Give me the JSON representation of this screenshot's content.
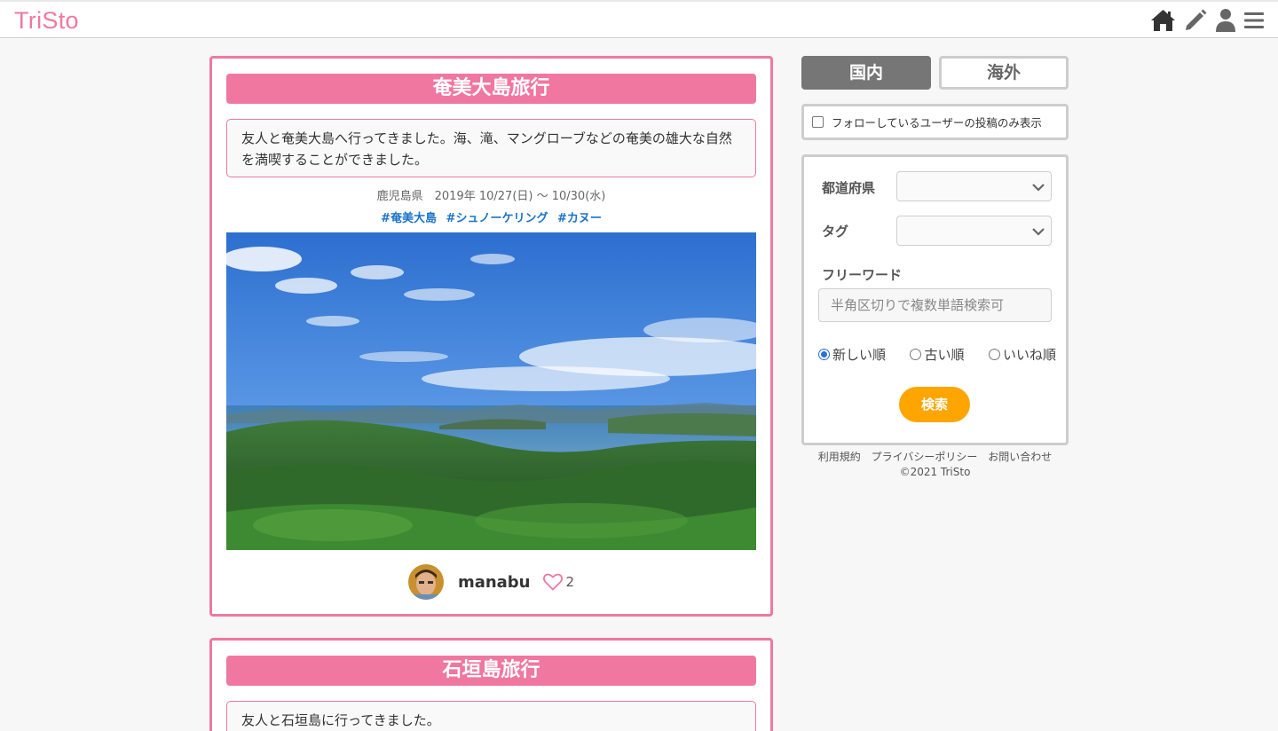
{
  "header": {
    "logo": "TriSto",
    "nav": [
      "home-icon",
      "pencil-icon",
      "user-icon",
      "menu-icon"
    ]
  },
  "posts": [
    {
      "title": "奄美大島旅行",
      "description": "友人と奄美大島へ行ってきました。海、滝、マングローブなどの奄美の雄大な自然を満喫することができました。",
      "meta": "鹿児島県　2019年 10/27(日) 〜 10/30(水)",
      "tags": [
        "#奄美大島",
        "#シュノーケリング",
        "#カヌー"
      ],
      "user": "manabu",
      "likes": "2"
    },
    {
      "title": "石垣島旅行",
      "description": "友人と石垣島に行ってきました。"
    }
  ],
  "sidebar": {
    "tabs": {
      "domestic": "国内",
      "overseas": "海外"
    },
    "follow_only": "フォローしているユーザーの投稿のみ表示",
    "search": {
      "prefecture_label": "都道府県",
      "tag_label": "タグ",
      "freeword_label": "フリーワード",
      "freeword_placeholder": "半角区切りで複数単語検索可",
      "sort_options": [
        "新しい順",
        "古い順",
        "いいね順"
      ],
      "sort_selected": "新しい順",
      "button": "検索"
    },
    "footer_links": [
      "利用規約",
      "プライバシーポリシー",
      "お問い合わせ"
    ],
    "copyright": "©2021 TriSto"
  },
  "colors": {
    "brand_pink": "#f077a0",
    "accent_orange": "#ffa500",
    "tag_blue": "#1a73c8"
  }
}
